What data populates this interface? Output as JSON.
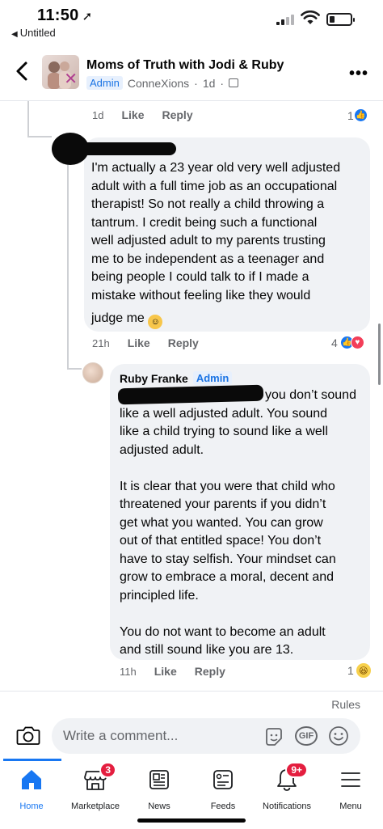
{
  "status_bar": {
    "time": "11:50",
    "back_app": "Untitled"
  },
  "header": {
    "group_name": "Moms of Truth with Jodi & Ruby",
    "admin_badge": "Admin",
    "author_name": "ConneXions",
    "post_time": "1d",
    "dot": "·"
  },
  "parent_comment_meta": {
    "time": "1d",
    "like": "Like",
    "reply": "Reply",
    "reaction_count": "1"
  },
  "comment": {
    "text_lines": [
      "I'm actually a 23 year old very well adjusted",
      "adult with a full time job as an occupational",
      "therapist! So not really a child throwing a",
      "tantrum. I credit being such a functional",
      "well adjusted adult to my parents trusting",
      "me to be independent as a teenager and",
      "being people I could talk to if I made a",
      "mistake without feeling like they would",
      "judge me"
    ],
    "emoji": "relieved-face",
    "time": "21h",
    "like": "Like",
    "reply": "Reply",
    "reaction_count": "4"
  },
  "reply": {
    "author": "Ruby Franke",
    "admin_badge": "Admin",
    "text_lines": [
      "you don’t sound",
      "like a well adjusted adult. You sound",
      "like a child trying to sound like a well",
      "adjusted adult.",
      "",
      "It is clear that you were that child who",
      "threatened your parents if you didn’t",
      "get what you wanted.  You can grow",
      "out of that entitled space! You don’t",
      "have to stay selfish. Your mindset can",
      "grow to embrace a moral, decent and",
      "principled life.",
      "",
      "You do not want to become an adult",
      "and still sound like you are 13."
    ],
    "time": "11h",
    "like": "Like",
    "reply": "Reply",
    "reaction_count": "1"
  },
  "rules_link": "Rules",
  "composer": {
    "placeholder": "Write a comment..."
  },
  "bottom_nav": {
    "items": [
      {
        "label": "Home",
        "icon": "home-icon",
        "active": true
      },
      {
        "label": "Marketplace",
        "icon": "marketplace-icon",
        "badge": "3"
      },
      {
        "label": "News",
        "icon": "news-icon"
      },
      {
        "label": "Feeds",
        "icon": "feeds-icon"
      },
      {
        "label": "Notifications",
        "icon": "bell-icon",
        "badge": "9+"
      },
      {
        "label": "Menu",
        "icon": "menu-icon"
      }
    ]
  },
  "colors": {
    "accent": "#1877f2",
    "badge": "#e41e3f",
    "bubble": "#f0f2f5",
    "secondary_text": "#65676b"
  }
}
